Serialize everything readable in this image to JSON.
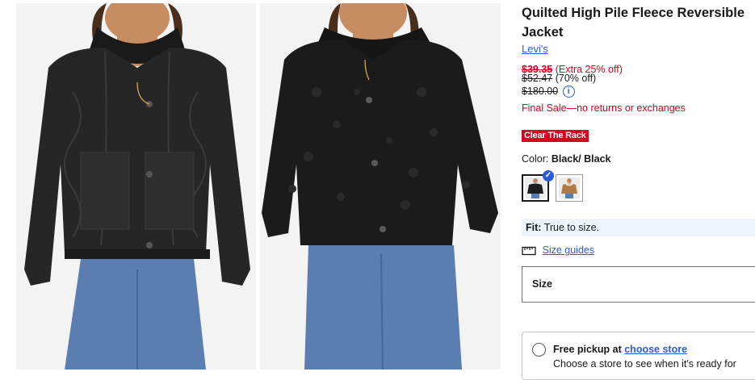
{
  "product": {
    "title": "Quilted High Pile Fleece Reversible Jacket",
    "brand": "Levi's"
  },
  "pricing": {
    "sale_price": "$39.35",
    "sale_discount": "(Extra 25% off)",
    "compare_price": "$52.47",
    "compare_discount": "(70% off)",
    "original_price": "$180.00",
    "info_icon_glyph": "i",
    "final_sale_note": "Final Sale—no returns or exchanges"
  },
  "badge": {
    "label": "Clear The Rack",
    "color": "#d6001c"
  },
  "color_selector": {
    "label": "Color:",
    "selected_value": "Black/ Black",
    "swatches": [
      {
        "name": "Black/ Black",
        "selected": true
      },
      {
        "name": "Tan",
        "selected": false
      }
    ],
    "check_glyph": "✓"
  },
  "fit": {
    "label": "Fit:",
    "value": "True to size."
  },
  "size_guides": {
    "icon": "ruler-icon",
    "label": "Size guides"
  },
  "size_select": {
    "label": "Size"
  },
  "pickup": {
    "title_prefix": "Free pickup at",
    "choose_store": "choose store",
    "subtext": "Choose a store to see when it's ready for"
  },
  "gallery": {
    "images": [
      {
        "alt": "Model wearing black quilted jacket side"
      },
      {
        "alt": "Model wearing black high pile fleece side"
      }
    ]
  },
  "colors": {
    "accent_blue": "#2a5bd7",
    "sale_red": "#d6001c",
    "fit_bg": "#edf4fd"
  }
}
